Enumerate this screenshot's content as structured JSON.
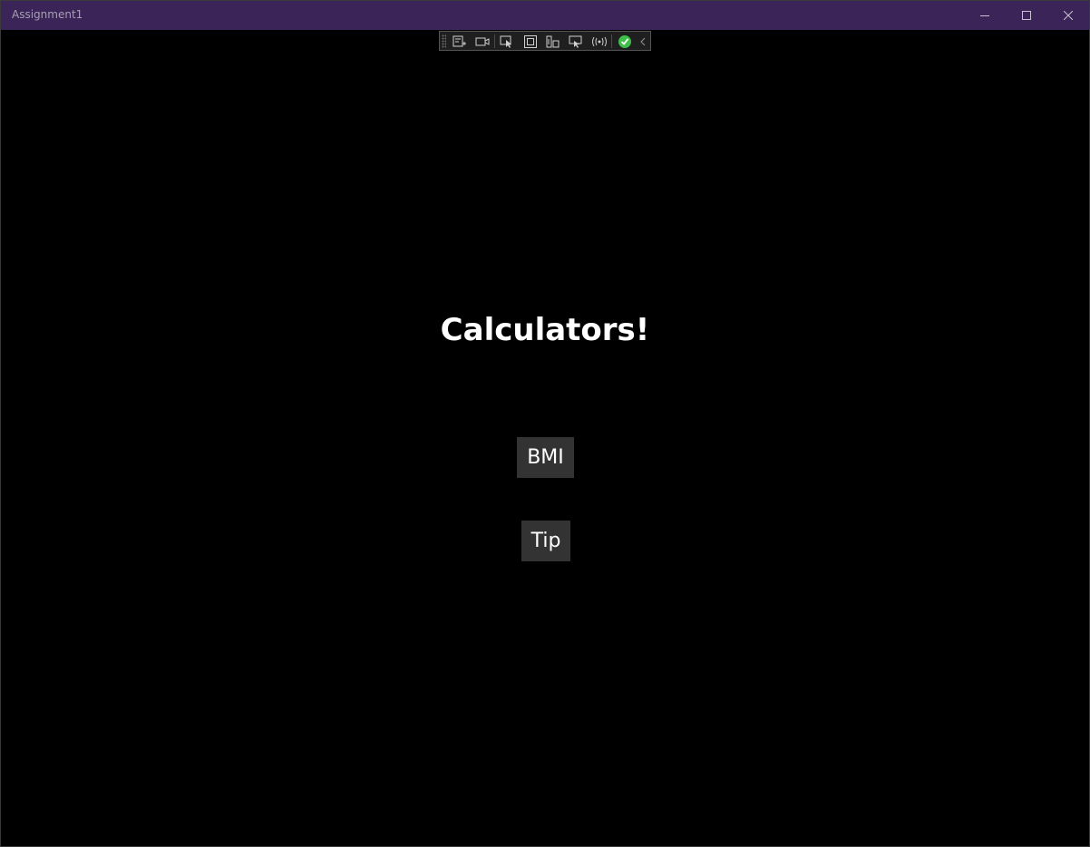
{
  "window": {
    "title": "Assignment1",
    "titlebar_color": "#3b2457",
    "controls": [
      "minimize-icon",
      "maximize-icon",
      "close-icon"
    ]
  },
  "debug_toolbar": {
    "tools": [
      "live-visual-tree-icon",
      "record-video-icon",
      "select-element-icon",
      "display-layout-adorners-icon",
      "track-focus-icon",
      "binding-failures-icon",
      "hot-reload-icon",
      "status-ok-icon",
      "collapse-chevron-icon"
    ],
    "status_color": "#3fbf4a"
  },
  "main": {
    "heading": "Calculators!",
    "buttons": [
      {
        "label": "BMI"
      },
      {
        "label": "Tip"
      }
    ],
    "button_color": "#333333",
    "background": "#000000"
  }
}
